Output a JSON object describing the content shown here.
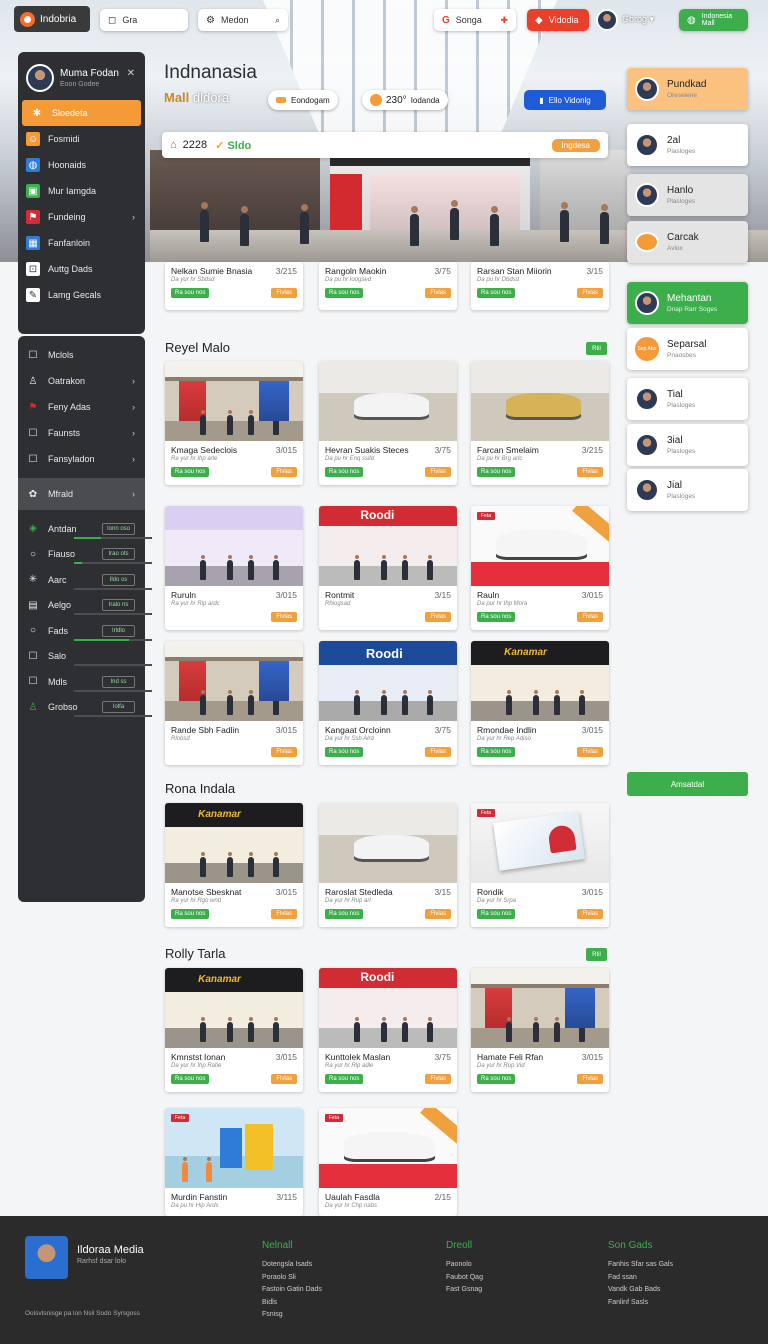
{
  "topbar": {
    "brand": "Indobria",
    "search1": "Gra",
    "search2": "Medon",
    "chip1": "Songa",
    "chip2": "Vidodia",
    "user": "Gbrog",
    "cta": "Indonesia Mall"
  },
  "hero": {
    "title": "Indnanasia",
    "sub_accent": "Mall",
    "sub_rest": "dldora",
    "chip1": "Eondogam",
    "chip2_num": "230°",
    "chip2_label": "Iodanda",
    "cta": "Ello Vidonlg",
    "strip_num": "2228",
    "strip_accent": "Sldo",
    "strip_pill": "Ingdesa"
  },
  "leftpanel": {
    "user": {
      "name": "Muma Fodan",
      "meta": "Eoon Godee"
    },
    "items": [
      {
        "label": "Sloedeta",
        "icon": "house-icon"
      },
      {
        "label": "Fosmidi",
        "icon": "face-icon"
      },
      {
        "label": "Hoonaids",
        "icon": "globe-icon"
      },
      {
        "label": "Mur Iamgda",
        "icon": "store-icon"
      },
      {
        "label": "Fundeing",
        "icon": "flag-icon"
      },
      {
        "label": "Fanfanloin",
        "icon": "map-icon"
      },
      {
        "label": "Auttg Dads",
        "icon": "cart-icon"
      },
      {
        "label": "Lamg Gecals",
        "icon": "edit-icon"
      }
    ],
    "items2": [
      {
        "label": "Mclols",
        "icon": "square-icon"
      },
      {
        "label": "Oatrakon",
        "icon": "person-icon"
      },
      {
        "label": "Feny Adas",
        "icon": "flag-icon"
      },
      {
        "label": "Faunsts",
        "icon": "square-icon"
      },
      {
        "label": "Fansyladon",
        "icon": "square-icon"
      },
      {
        "label": "Mfrald",
        "icon": "gear-icon"
      },
      {
        "label": "Antdan",
        "icon": "tag-icon",
        "mini": "Ionn oso",
        "bar": 0.35
      },
      {
        "label": "Fiauso",
        "icon": "circle-icon",
        "mini": "Irao ots",
        "bar": 0.1
      },
      {
        "label": "Aarc",
        "icon": "asterisk-icon",
        "mini": "Ildo os",
        "bar": 0
      },
      {
        "label": "Aelgo",
        "icon": "calendar-icon",
        "mini": "Iralo ns",
        "bar": 0
      },
      {
        "label": "Fads",
        "icon": "circle-icon",
        "mini": "Irldlo",
        "bar": 0.7
      },
      {
        "label": "Salo",
        "icon": "square-icon",
        "mini": "",
        "bar": 0
      },
      {
        "label": "Mdls",
        "icon": "square-icon",
        "mini": "Ind ss",
        "bar": 0
      },
      {
        "label": "Grobso",
        "icon": "person-icon",
        "mini": "Iolfa",
        "bar": 0
      }
    ]
  },
  "sections": [
    {
      "title": "Reyel Malo",
      "tag": "Rtil"
    },
    {
      "title": "Rona Indala",
      "tag": ""
    },
    {
      "title": "Rolly Tarla",
      "tag": "Rtil"
    }
  ],
  "cards_strip": [
    {
      "name": "Nelkan Sumie Bnasia",
      "price": "3/215",
      "meta": "Da yur hr Sbdsd"
    },
    {
      "name": "Rangoln Maokin",
      "price": "3/75",
      "meta": "Da pu hr Ioogsed"
    },
    {
      "name": "Rarsan Stan Miiorin",
      "price": "3/15",
      "meta": "Da pu hr Dbdsd"
    }
  ],
  "cards": [
    {
      "name": "Kmaga Sedeclois",
      "price": "3/015",
      "meta": "Ra yur hr Ihp arle"
    },
    {
      "name": "Hevran Suakis Steces",
      "price": "3/75",
      "meta": "Da pu hr Enq sslld"
    },
    {
      "name": "Farcan Smelaim",
      "price": "3/215",
      "meta": "Da pu hr Brg arlc"
    },
    {
      "name": "Ruruln",
      "price": "3/015",
      "meta": "Ra yur hr Rip ardc"
    },
    {
      "name": "Rontmit",
      "price": "3/15",
      "meta": "Rhiogsad"
    },
    {
      "name": "Rauln",
      "price": "3/015",
      "meta": "Da pur hr Ihp Mora"
    },
    {
      "name": "Rande Sbh Fadlin",
      "price": "3/015",
      "meta": "Rlobsd"
    },
    {
      "name": "Kangaat Orcloinn",
      "price": "3/75",
      "meta": "Da yur hr Ssb Alrd"
    },
    {
      "name": "Rmondae Indlin",
      "price": "3/015",
      "meta": "Da yur hr Rep Adiso"
    },
    {
      "name": "Manotse Sbesknat",
      "price": "3/015",
      "meta": "Ra yur hr Rgo wnd"
    },
    {
      "name": "Raroslat Stedleda",
      "price": "3/15",
      "meta": "Da yur hr Rup arl"
    },
    {
      "name": "Rondik",
      "price": "3/015",
      "meta": "Da yur hr Srpa"
    },
    {
      "name": "Kmnstst Ionan",
      "price": "3/015",
      "meta": "Da yur hr Ihp Ratie"
    },
    {
      "name": "Kunttolek Maslan",
      "price": "3/75",
      "meta": "Ra yur hr Rlp adle"
    },
    {
      "name": "Hamate Feli Rfan",
      "price": "3/015",
      "meta": "Da yur hr Rup Vid"
    },
    {
      "name": "Murdin Fanstin",
      "price": "3/115",
      "meta": "Da pu hr Hip Ards"
    },
    {
      "name": "Uaulah Fasdla",
      "price": "2/15",
      "meta": "Da yur hr Chp nabs"
    }
  ],
  "card_labels": {
    "green": "Ra sou nos",
    "orange": "Flvlas"
  },
  "badges": {
    "promo": "Feta",
    "redstore": "Roodi",
    "bluestore": "Roodi",
    "darkstore": "Kanamar"
  },
  "rightpanel": [
    {
      "t1": "Pundkad",
      "t2": "Oreseiene",
      "style": "orange"
    },
    {
      "t1": "2al",
      "t2": "Plasloges",
      "style": ""
    },
    {
      "t1": "Hanlo",
      "t2": "Plasloges",
      "style": "grey"
    },
    {
      "t1": "Carcak",
      "t2": "Avlox",
      "style": "grey"
    },
    {
      "t1": "Mehantan",
      "t2": "Dnap Rarr Soges",
      "style": "green"
    },
    {
      "t1": "Separsal",
      "t2": "Pnaosbes",
      "style": "orangedot",
      "dot": "Sep Abn"
    },
    {
      "t1": "Tial",
      "t2": "Plasloges",
      "style": ""
    },
    {
      "t1": "3ial",
      "t2": "Plasloges",
      "style": ""
    },
    {
      "t1": "Jial",
      "t2": "Plasloges",
      "style": ""
    }
  ],
  "right_button": "Amsatdal",
  "footer": {
    "name": "Ildoraa Media",
    "tagline": "Rarhsf dsar lolo",
    "copy": "Oolsvtsnisge pa lon Nsil Sodo Syrsgoss",
    "col1": {
      "title": "Nelnall",
      "items": [
        "Dotengsla Isads",
        "Poraolo Sli",
        "Fastoin Gatin Dads",
        "Bidls",
        "Fsnisg"
      ]
    },
    "col2": {
      "title": "Dreoll",
      "items": [
        "Paonolo",
        "Faubot Qag",
        "Fast Gsnag"
      ]
    },
    "col3": {
      "title": "Son Gads",
      "items": [
        "Fanhis Sfar sas Gals",
        "Fad ssan",
        "Vandk Gab Bads",
        "Fanlinf Sasls"
      ]
    }
  }
}
